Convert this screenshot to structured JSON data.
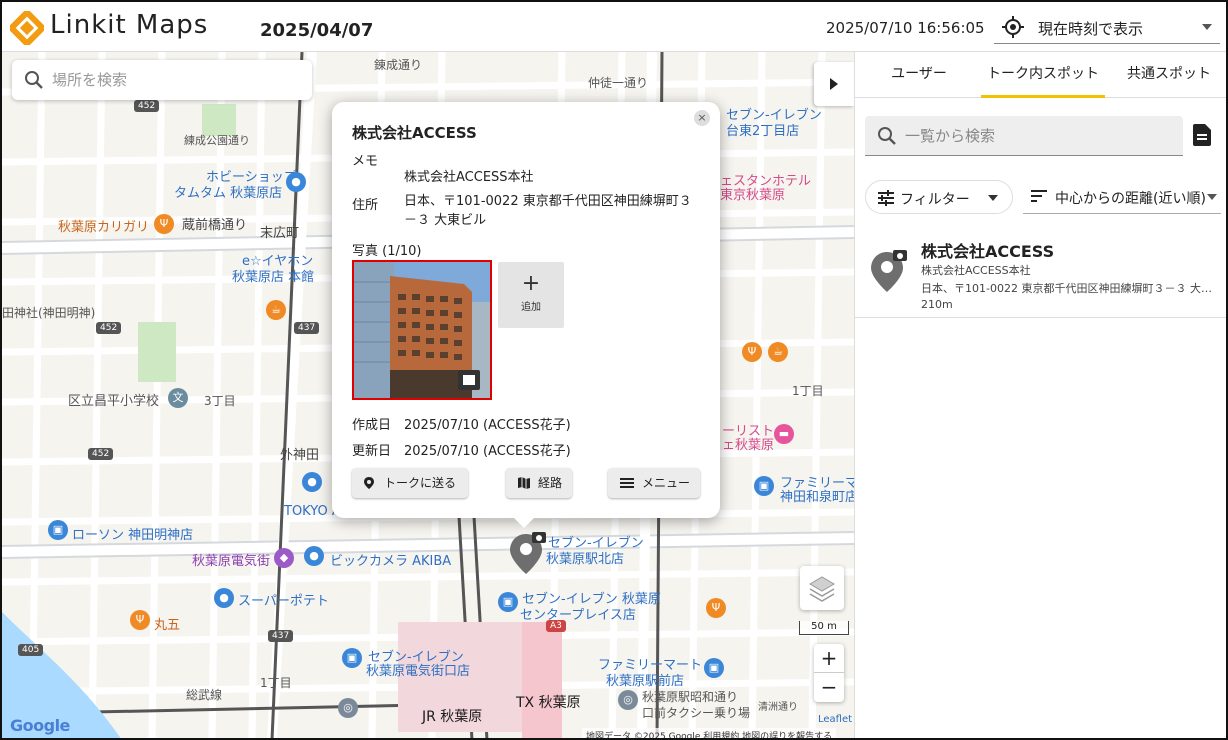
{
  "header": {
    "app_name": "Linkit Maps",
    "date": "2025/04/07",
    "current_time": "2025/07/10 16:56:05",
    "time_mode_select": "現在時刻で表示"
  },
  "map": {
    "search_placeholder": "場所を検索",
    "labels": {
      "hobby": "ホビーショップ",
      "tamtam": "タムタム 秋葉原店",
      "karigari": "秋葉原カリガリ",
      "kuramae": "蔵前橋通り",
      "suehirocho": "末広町",
      "eearphone": "e☆イヤホン",
      "eearphone2": "秋葉原店 本館",
      "kanda_myojin": "田神社(神田明神)",
      "shoheisho": "区立昌平小学校",
      "sotokanda": "外神田",
      "tokyo_a": "TOKYO A",
      "lawson": "ローソン 神田明神店",
      "akiba_denki": "秋葉原電気街",
      "bic": "ビックカメラ AKIBA",
      "super_potato": "スーパーポテト",
      "maru5": "丸五",
      "se_denki": "セブン-イレブン",
      "se_denki2": "秋葉原電気街口店",
      "se_kitaguchi": "セブン-イレブン",
      "se_kitaguchi2": "秋葉原駅北店",
      "se_center": "セブン-イレブン 秋葉原",
      "se_center2": "センタープレイス店",
      "fm_ekimae": "ファミリーマート",
      "fm_ekimae2": "秋葉原駅前店",
      "fm_izumi": "ファミリーマ",
      "fm_izumi2": "神田和泉町店",
      "showa_dori": "秋葉原駅昭和通り",
      "taxi": "口前タクシー乗り場",
      "jr_akihabara": "JR 秋葉原",
      "tx_akihabara": "TX 秋葉原",
      "se_kuramae": "セブン-イレブン",
      "se_kuramae2": "台東2丁目店",
      "hotel": "ェスタンホテル",
      "hotel2": "東京秋葉原",
      "list": "ーリスト",
      "list2": "ェ秋葉原",
      "renbo": "錬成通り",
      "nakacho": "仲徒一通り",
      "chome1": "1丁目",
      "chome3": "3丁目",
      "chome1b": "1丁目",
      "sobu": "総武線",
      "kiyosubashi": "清洲通り",
      "koen": "練成公園通り",
      "a3": "A3"
    },
    "scale": "50 m",
    "zoom_in": "+",
    "zoom_out": "−",
    "leaflet": "Leaflet",
    "google": "Google",
    "attribution": "地図データ ©2025 Google   利用規約   地図の誤りを報告する"
  },
  "popup": {
    "title": "株式会社ACCESS",
    "memo_label": "メモ",
    "memo_value": "株式会社ACCESS本社",
    "address_label": "住所",
    "address_line1": "日本、〒101-0022 東京都千代田区神田練塀町３",
    "address_line2": "－３ 大東ビル",
    "photo_label": "写真 (1/10)",
    "add_label": "追加",
    "created_label": "作成日",
    "created_value": "2025/07/10 (ACCESS花子)",
    "updated_label": "更新日",
    "updated_value": "2025/07/10 (ACCESS花子)",
    "send_button": "トークに送る",
    "route_button": "経路",
    "menu_button": "メニュー",
    "close": "×"
  },
  "side": {
    "tabs": [
      "ユーザー",
      "トーク内スポット",
      "共通スポット"
    ],
    "active_tab": 1,
    "search_placeholder": "一覧から検索",
    "filter_label": "フィルター",
    "sort_label": "中心からの距離(近い順)",
    "items": [
      {
        "name": "株式会社ACCESS",
        "memo": "株式会社ACCESS本社",
        "address": "日本、〒101-0022 東京都千代田区神田練塀町３－３ 大…",
        "distance": "210m"
      }
    ]
  },
  "colors": {
    "accent": "#f2c200",
    "logo_orange": "#f39c12",
    "highlight_red": "#e10000"
  }
}
